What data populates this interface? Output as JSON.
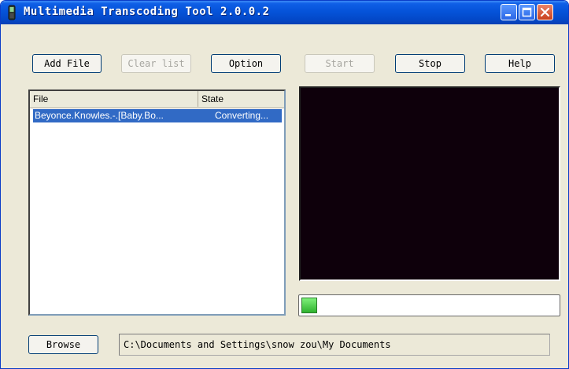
{
  "window": {
    "title": "Multimedia Transcoding Tool  2.0.0.2"
  },
  "toolbar": {
    "add_file": "Add File",
    "clear_list": "Clear list",
    "option": "Option",
    "start": "Start",
    "stop": "Stop",
    "help": "Help"
  },
  "file_list": {
    "columns": [
      "File",
      "State"
    ],
    "rows": [
      {
        "file": "Beyonce.Knowles.-.[Baby.Bo...",
        "state": "Converting..."
      }
    ]
  },
  "progress": {
    "fraction": 0.06,
    "fill_color": "#2fb22f"
  },
  "footer": {
    "browse": "Browse",
    "path": "C:\\Documents and Settings\\snow zou\\My Documents"
  },
  "colors": {
    "titlebar": "#0553d9",
    "preview_bg": "#0e000b",
    "selection": "#316ac5"
  }
}
